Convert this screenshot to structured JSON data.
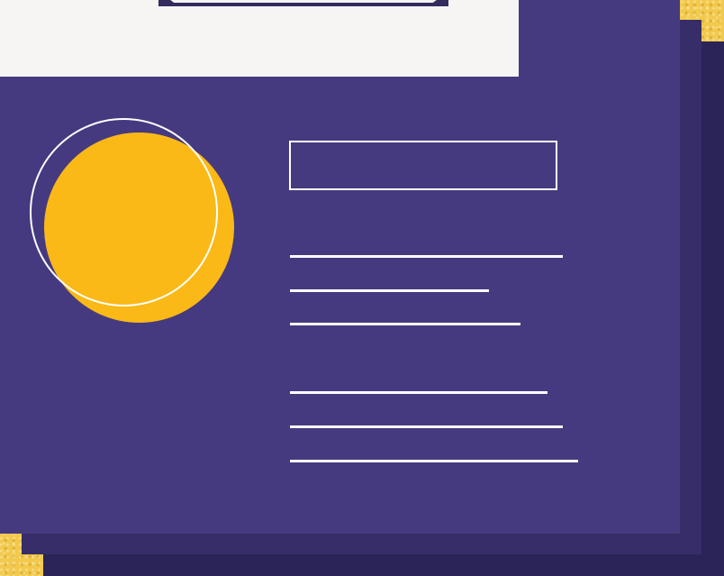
{
  "colors": {
    "background_gold": "#f2c94c",
    "card_front": "#453a80",
    "card_middle": "#372d68",
    "card_back": "#2b2458",
    "top_panel": "#f6f5f3",
    "accent_yellow": "#fbb917",
    "line_white": "#ffffff"
  },
  "icons": {
    "yellow_circle": "filled-circle",
    "outline_circle": "circle-outline",
    "title_box": "rectangle-outline"
  }
}
